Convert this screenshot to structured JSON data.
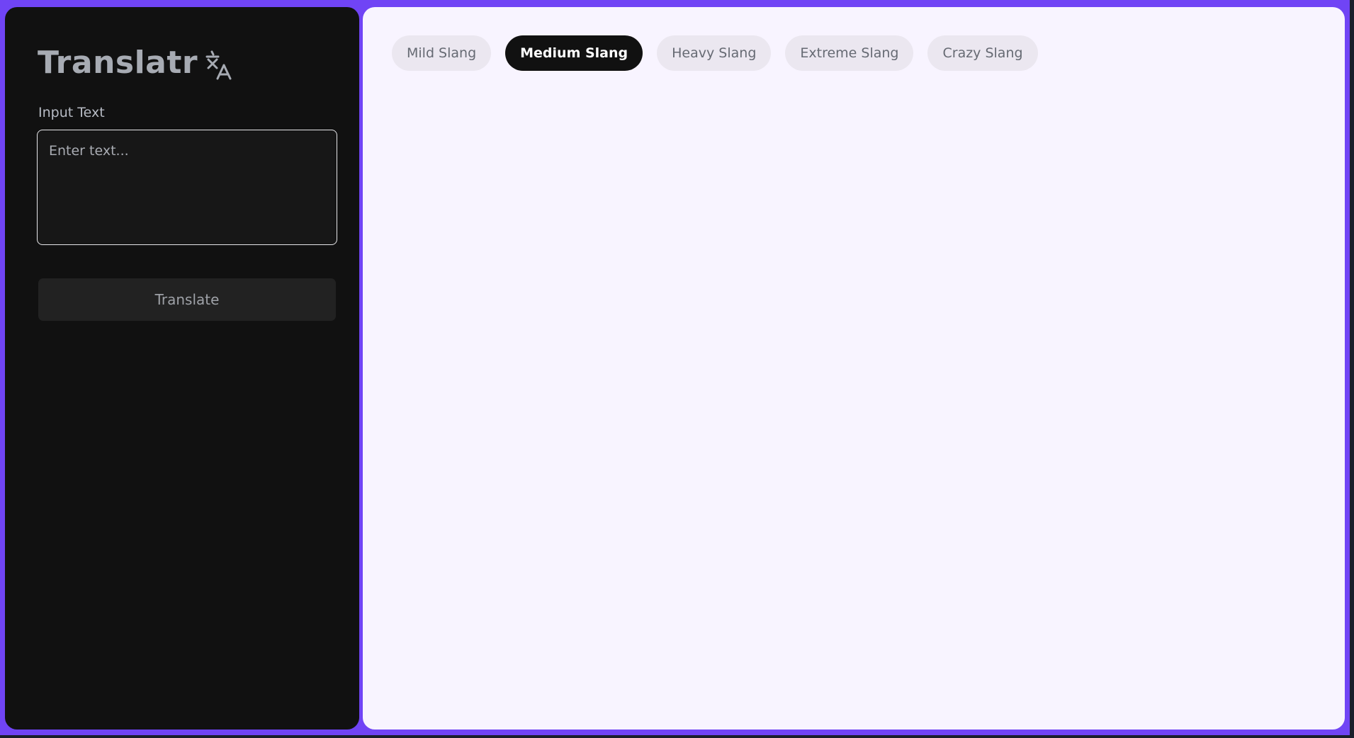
{
  "app": {
    "title": "Translatr",
    "icon": "translate-icon"
  },
  "input": {
    "label": "Input Text",
    "placeholder": "Enter text...",
    "value": ""
  },
  "actions": {
    "translate_label": "Translate"
  },
  "slang_levels": [
    {
      "label": "Mild Slang",
      "active": false
    },
    {
      "label": "Medium Slang",
      "active": true
    },
    {
      "label": "Heavy Slang",
      "active": false
    },
    {
      "label": "Extreme Slang",
      "active": false
    },
    {
      "label": "Crazy Slang",
      "active": false
    }
  ],
  "colors": {
    "accent": "#7044f5",
    "sidebar_bg": "#111111",
    "main_bg": "#f8f4ff",
    "tab_active": "#111111",
    "tab_inactive": "#ebe7f0"
  }
}
